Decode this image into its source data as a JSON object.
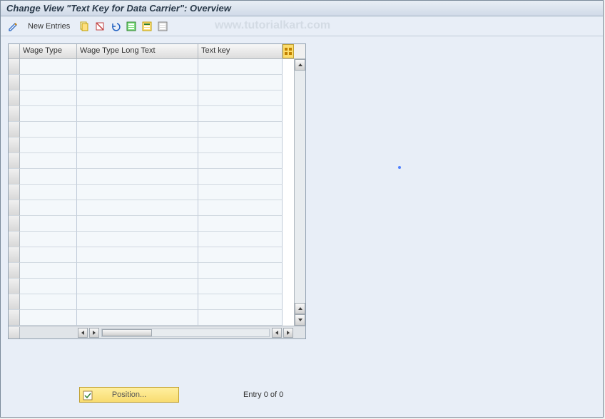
{
  "header": {
    "title": "Change View \"Text Key for Data Carrier\": Overview"
  },
  "toolbar": {
    "new_entries_label": "New Entries"
  },
  "watermark": "www.tutorialkart.com",
  "table": {
    "columns": {
      "wage_type": "Wage Type",
      "wage_type_long_text": "Wage Type Long Text",
      "text_key": "Text key"
    },
    "row_count": 17
  },
  "footer": {
    "position_label": "Position...",
    "entry_text": "Entry 0 of 0"
  }
}
